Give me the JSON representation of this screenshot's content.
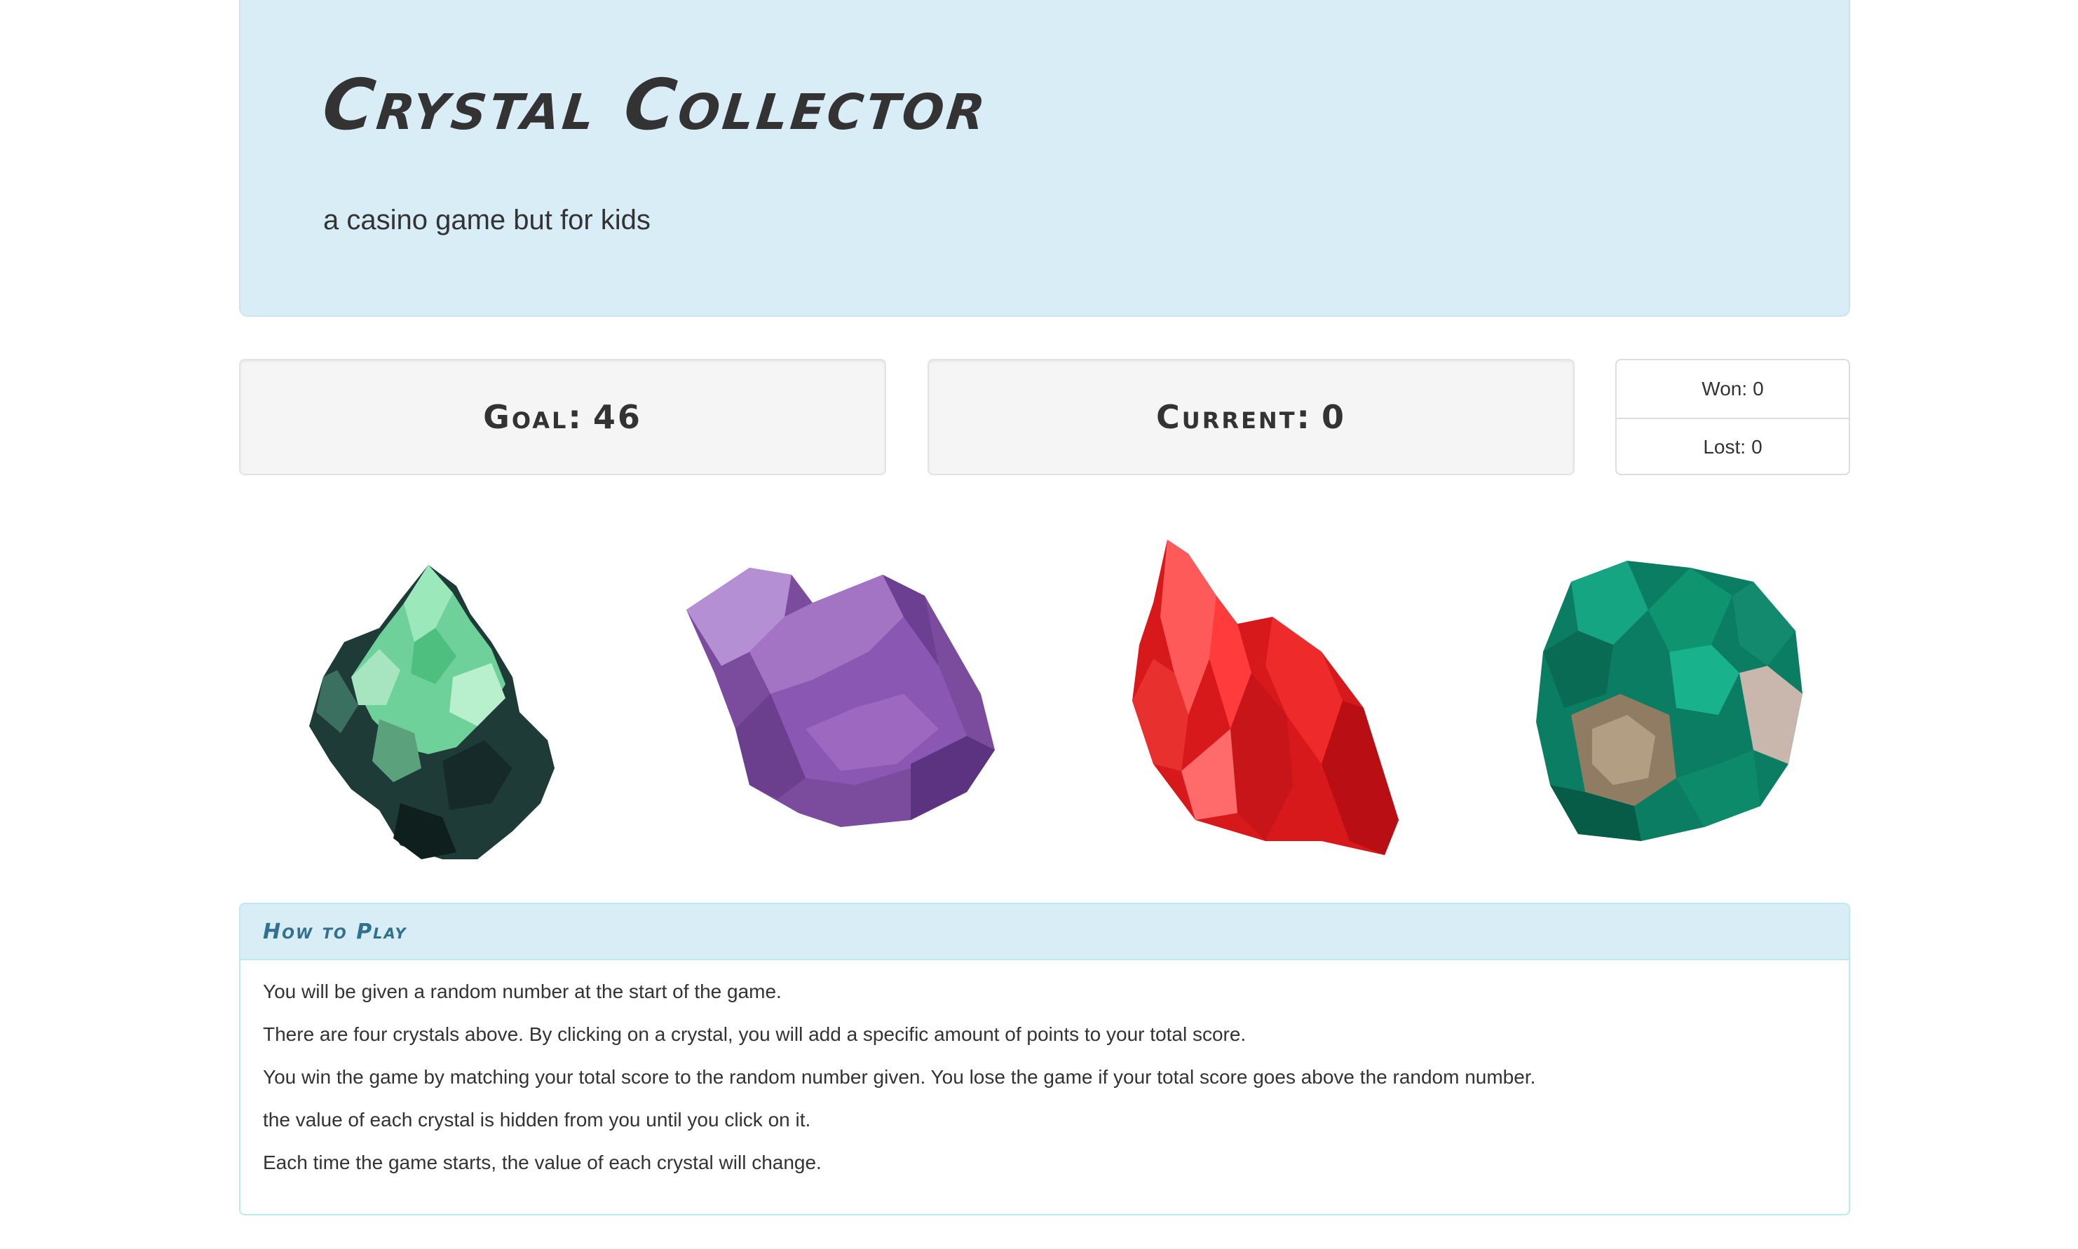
{
  "header": {
    "title": "Crystal Collector",
    "subtitle": "a casino game but for kids"
  },
  "scoreboard": {
    "goal_label": "Goal:",
    "goal_value": "46",
    "current_label": "Current:",
    "current_value": "0",
    "won_label": "Won:",
    "won_value": "0",
    "lost_label": "Lost:",
    "lost_value": "0"
  },
  "crystals": [
    {
      "name": "green crystal",
      "icon": "green-crystal-icon",
      "color": "#5cc48a"
    },
    {
      "name": "purple crystal",
      "icon": "purple-crystal-icon",
      "color": "#8e5fb0"
    },
    {
      "name": "red crystal",
      "icon": "red-crystal-icon",
      "color": "#e02a2a"
    },
    {
      "name": "teal crystal",
      "icon": "teal-crystal-icon",
      "color": "#0f8f73"
    }
  ],
  "instructions": {
    "title": "How to Play",
    "lines": [
      "You will be given a random number at the start of the game.",
      "There are four crystals above. By clicking on a crystal, you will add a specific amount of points to your total score.",
      "You win the game by matching your total score to the random number given. You lose the game if your total score goes above the random number.",
      "the value of each crystal is hidden from you until you click on it.",
      "Each time the game starts, the value of each crystal will change."
    ]
  },
  "colors": {
    "jumbotron_bg": "#d9edf7",
    "well_bg": "#f5f5f5",
    "panel_heading_bg": "#d9edf7",
    "panel_title": "#31708f",
    "panel_border": "#bce8f1"
  }
}
